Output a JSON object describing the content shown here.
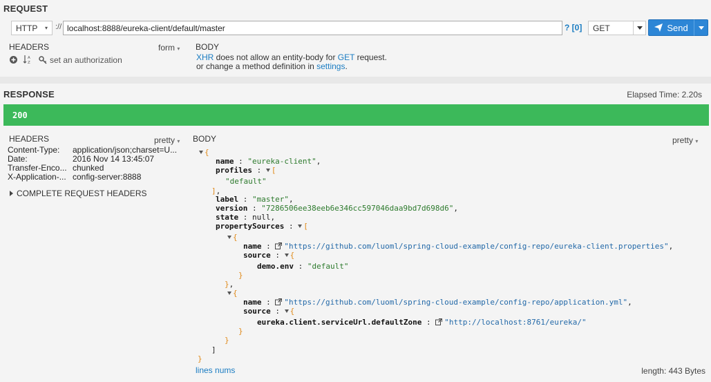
{
  "request": {
    "title": "REQUEST",
    "scheme": "HTTP",
    "scheme_sep": "://",
    "url": "localhost:8888/eureka-client/default/master",
    "help_label": "? [0]",
    "method": "GET",
    "send_label": "Send",
    "headers_label": "HEADERS",
    "form_label": "form",
    "auth_label": "set an authorization",
    "body_label": "BODY",
    "body_msg": {
      "xhr": "XHR",
      "part1": " does not allow an entity-body for ",
      "get": "GET",
      "part2": " request.",
      "line2a": "or change a method definition in ",
      "settings": "settings",
      "line2b": "."
    }
  },
  "response": {
    "title": "RESPONSE",
    "elapsed": "Elapsed Time: 2.20s",
    "status": "200",
    "headers_label": "HEADERS",
    "pretty_label": "pretty",
    "headers": [
      {
        "name": "Content-Type:",
        "value": "application/json;charset=U..."
      },
      {
        "name": "Date:",
        "value": "2016 Nov 14 13:45:07"
      },
      {
        "name": "Transfer-Enco...",
        "value": "chunked"
      },
      {
        "name": "X-Application-...",
        "value": "config-server:8888"
      }
    ],
    "complete_headers": "COMPLETE REQUEST HEADERS",
    "body_label": "BODY",
    "body_pretty": "pretty",
    "lines_nums": "lines nums",
    "length": "length: 443 Bytes",
    "json": {
      "name_key": "name",
      "name_val": "\"eureka-client\"",
      "profiles_key": "profiles",
      "profile0": "\"default\"",
      "label_key": "label",
      "label_val": "\"master\"",
      "version_key": "version",
      "version_val": "\"7286506ee38eeb6e346cc597046daa9bd7d698d6\"",
      "state_key": "state",
      "state_val": "null",
      "ps_key": "propertySources",
      "ps0_name": "\"https://github.com/luoml/spring-cloud-example/config-repo/eureka-client.properties\"",
      "source_key": "source",
      "ps0_src_key": "demo.env",
      "ps0_src_val": "\"default\"",
      "ps1_name": "\"https://github.com/luoml/spring-cloud-example/config-repo/application.yml\"",
      "ps1_src_key": "eureka.client.serviceUrl.defaultZone",
      "ps1_src_val": "\"http://localhost:8761/eureka/\""
    }
  },
  "colors": {
    "status_ok": "#3cb95a",
    "accent": "#2d86d6",
    "string": "#2d7a2d",
    "bracket": "#e08a1a"
  }
}
